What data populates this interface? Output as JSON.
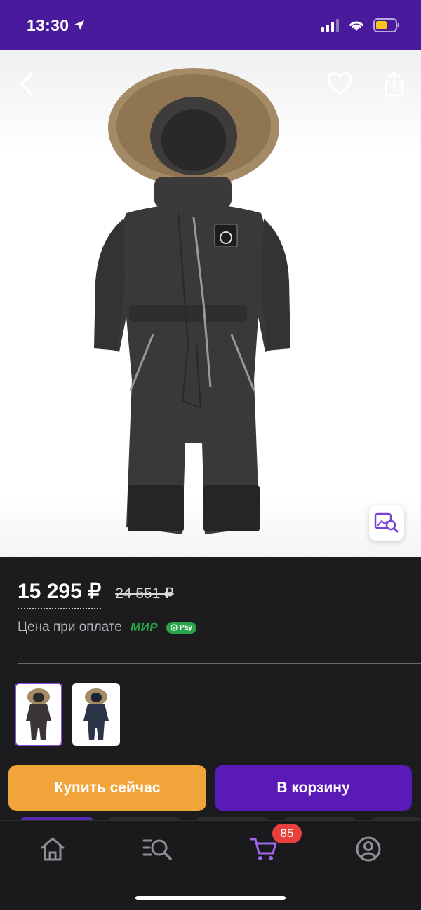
{
  "status": {
    "time": "13:30",
    "battery_color": "#f5c518"
  },
  "nav": {
    "back_icon": "chevron-left-icon",
    "favorite_icon": "heart-icon",
    "share_icon": "share-icon",
    "visual_search_icon": "image-search-icon"
  },
  "price": {
    "current": "15 295 ₽",
    "old": "24 551 ₽"
  },
  "payment": {
    "label": "Цена при оплате",
    "mir_logo": "МИР",
    "pay_badge": "Pay"
  },
  "variants": [
    {
      "name": "dark-grey",
      "color": "#3a3638",
      "selected": true
    },
    {
      "name": "navy",
      "color": "#2c3447",
      "selected": false
    }
  ],
  "actions": {
    "buy_now": "Купить сейчас",
    "add_to_cart": "В корзину"
  },
  "tabbar": {
    "items": [
      {
        "icon": "home-icon",
        "color": "#8e8e93"
      },
      {
        "icon": "catalog-search-icon",
        "color": "#8e8e93"
      },
      {
        "icon": "cart-icon",
        "color": "#a066f0"
      },
      {
        "icon": "profile-icon",
        "color": "#8e8e93"
      }
    ],
    "cart_count": "85"
  },
  "colors": {
    "brand_purple": "#4a1a9c",
    "buy_orange": "#f0a43a",
    "cart_purple": "#5a1ab8",
    "badge_red": "#e8403c"
  }
}
